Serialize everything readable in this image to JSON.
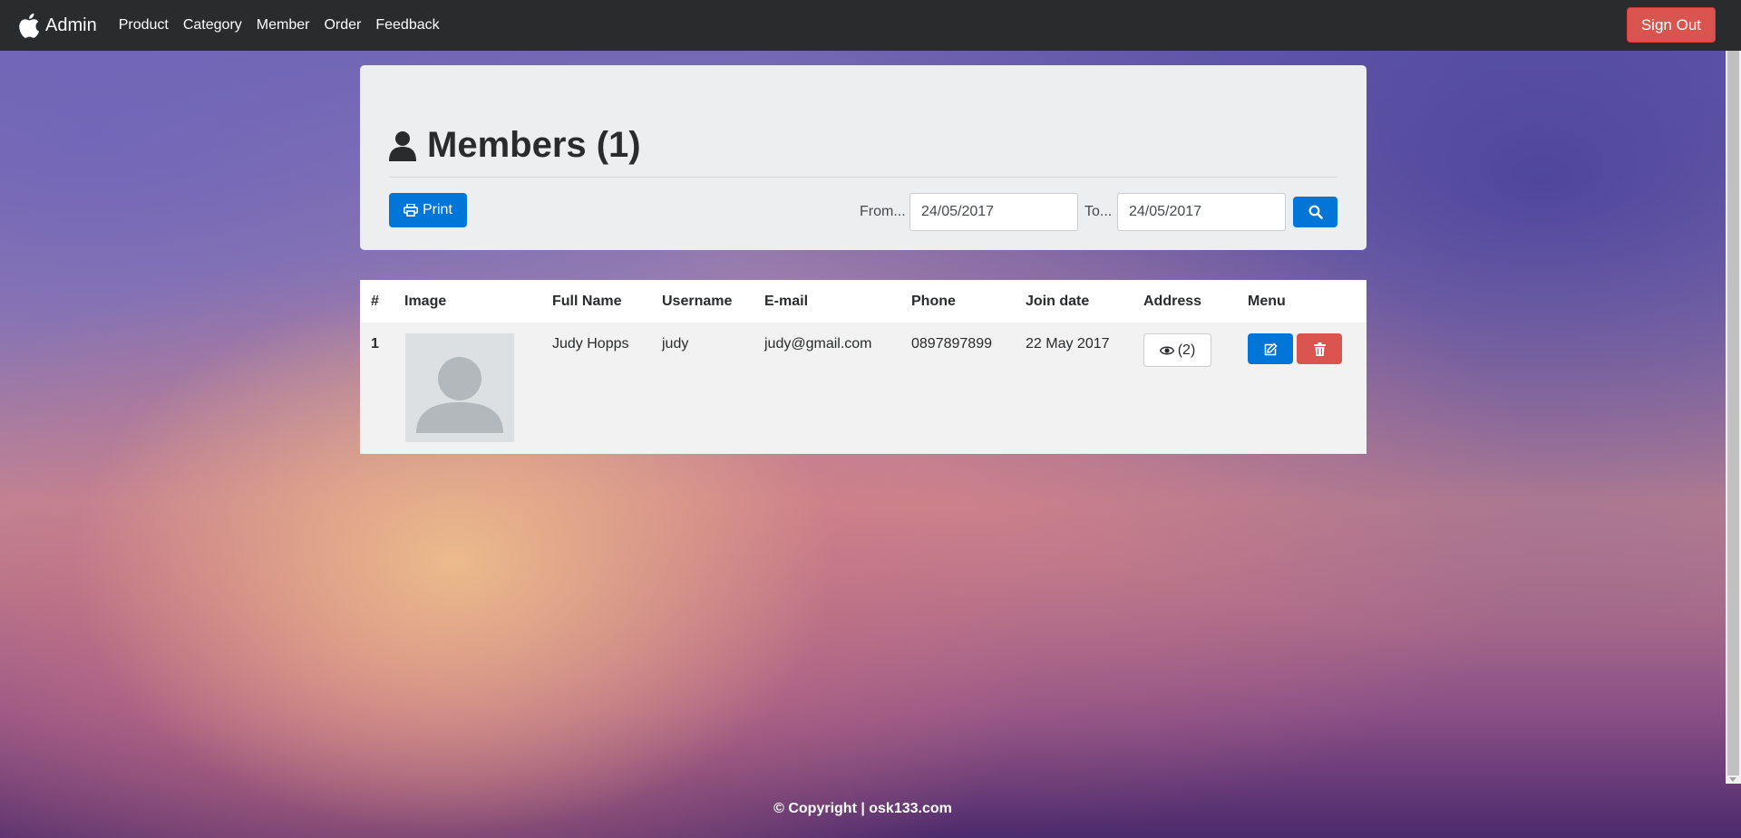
{
  "navbar": {
    "brand": "Admin",
    "links": [
      "Product",
      "Category",
      "Member",
      "Order",
      "Feedback"
    ],
    "signout_label": "Sign Out"
  },
  "header": {
    "title": "Members (1)",
    "print_label": "Print",
    "from_label": "From...",
    "to_label": "To...",
    "from_value": "24/05/2017",
    "to_value": "24/05/2017"
  },
  "table": {
    "columns": [
      "#",
      "Image",
      "Full Name",
      "Username",
      "E-mail",
      "Phone",
      "Join date",
      "Address",
      "Menu"
    ],
    "rows": [
      {
        "index": "1",
        "full_name": "Judy Hopps",
        "username": "judy",
        "email": "judy@gmail.com",
        "phone": "0897897899",
        "join_date": "22 May 2017",
        "address_count": "(2)"
      }
    ]
  },
  "footer": {
    "text": "© Copyright | osk133.com"
  },
  "colors": {
    "primary": "#0275d8",
    "danger": "#d9534f",
    "navbar": "#292b2c"
  },
  "icons": [
    "apple-icon",
    "user-icon",
    "print-icon",
    "search-icon",
    "eye-icon",
    "edit-icon",
    "trash-icon"
  ]
}
